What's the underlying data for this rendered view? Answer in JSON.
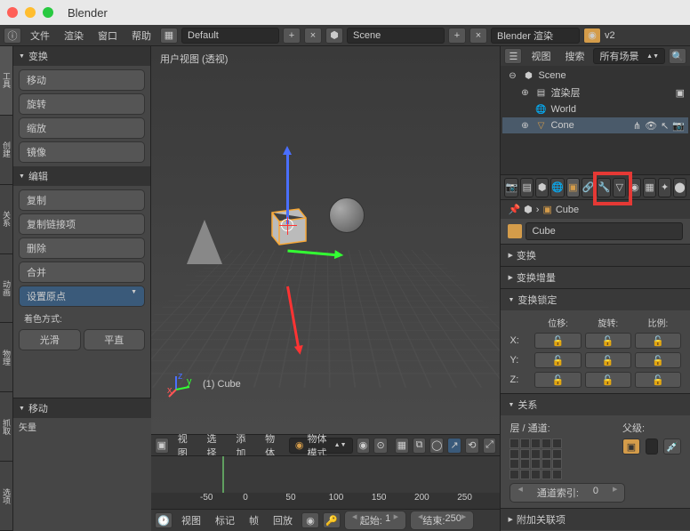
{
  "title": "Blender",
  "infobar": {
    "menus": [
      "文件",
      "渲染",
      "窗口",
      "帮助"
    ],
    "layout_dd": "Default",
    "scene_dd": "Scene",
    "engine_dd": "Blender 渲染",
    "version": "v2"
  },
  "toolshelf": {
    "tabs": [
      "工具",
      "创建",
      "关系",
      "动画",
      "物理",
      "抓取",
      "选项"
    ],
    "transform_hdr": "变换",
    "transform_btns": [
      "移动",
      "旋转",
      "缩放",
      "镜像"
    ],
    "edit_hdr": "编辑",
    "edit_btns": [
      "复制",
      "复制链接项",
      "删除",
      "合并"
    ],
    "origin_btn": "设置原点",
    "shading_label": "着色方式:",
    "shading_btns": [
      "光滑",
      "平直"
    ],
    "op_hdr": "移动",
    "op_label": "矢量"
  },
  "viewport": {
    "label": "用户视图 (透视)",
    "obj": "(1) Cube",
    "header_menus": [
      "视图",
      "选择",
      "添加",
      "物体"
    ],
    "mode_dd": "物体模式"
  },
  "timeline": {
    "ticks": [
      "-50",
      "0",
      "50",
      "100",
      "150",
      "200",
      "250"
    ],
    "menus": [
      "视图",
      "标记",
      "帧",
      "回放"
    ],
    "start_label": "起始:",
    "start_val": "1",
    "end_label": "结束:",
    "end_val": "250"
  },
  "outliner": {
    "menus": [
      "视图",
      "搜索"
    ],
    "filter_dd": "所有场景",
    "items": [
      {
        "name": "Scene",
        "depth": 0,
        "icon": "scene"
      },
      {
        "name": "渲染层",
        "depth": 1,
        "icon": "layers"
      },
      {
        "name": "World",
        "depth": 1,
        "icon": "world"
      },
      {
        "name": "Cone",
        "depth": 1,
        "icon": "mesh",
        "sel": true
      }
    ]
  },
  "properties": {
    "breadcrumb": "Cube",
    "name_field": "Cube",
    "sec_transform": "变换",
    "sec_delta": "变换增量",
    "sec_lock": "变换锁定",
    "lock_cols": [
      "位移:",
      "旋转:",
      "比例:"
    ],
    "lock_rows": [
      "X:",
      "Y:",
      "Z:"
    ],
    "sec_relations": "关系",
    "layer_label": "层 / 通道:",
    "parent_label": "父级:",
    "passindex_label": "通道索引:",
    "passindex_val": "0",
    "sec_extras": "附加关联项"
  }
}
